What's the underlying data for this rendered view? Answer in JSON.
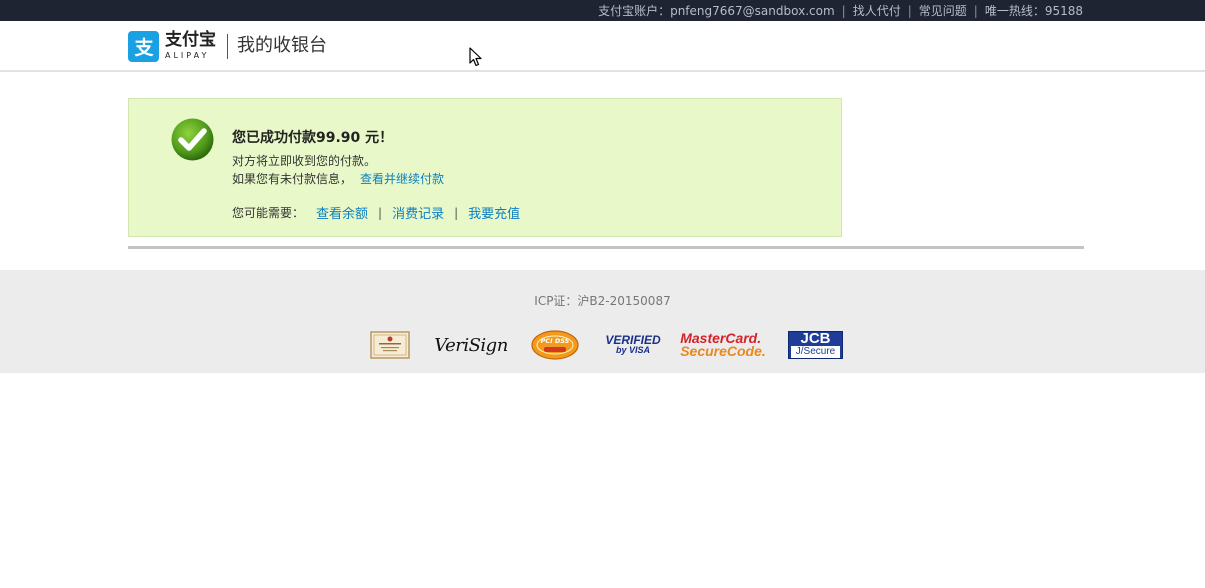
{
  "topbar": {
    "account_label": "支付宝账户：pnfeng7667@sandbox.com",
    "proxy_pay": "找人代付",
    "faq": "常见问题",
    "hotline": "唯一热线：95188"
  },
  "header": {
    "logo_cn": "支付宝",
    "logo_en": "ALIPAY",
    "title": "我的收银台"
  },
  "result": {
    "title": "您已成功付款99.90 元！",
    "line1": "对方将立即收到您的付款。",
    "line2_text": "如果您有未付款信息，",
    "line2_link": "查看并继续付款",
    "suggest_label": "您可能需要：",
    "links": [
      "查看余额",
      "消费记录",
      "我要充值"
    ],
    "status_color": "#5aa51e"
  },
  "footer": {
    "icp": "ICP证：沪B2-20150087",
    "badges": {
      "verisign": "VeriSign",
      "pci": "PCI DSS",
      "visa_line1": "VERIFIED",
      "visa_line2": "by VISA",
      "mc_line1": "MasterCard.",
      "mc_line2": "SecureCode.",
      "jcb_line1": "JCB",
      "jcb_line2": "J/Secure"
    }
  }
}
